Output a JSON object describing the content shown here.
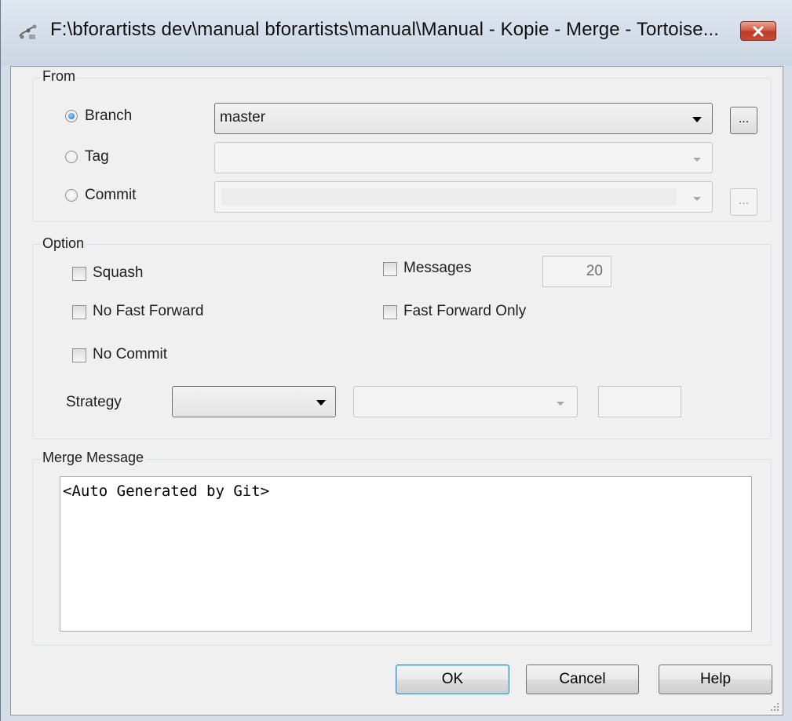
{
  "window": {
    "title": "F:\\bforartists dev\\manual bforartists\\manual\\Manual - Kopie - Merge - Tortoise..."
  },
  "from": {
    "group_label": "From",
    "branch": {
      "label": "Branch",
      "selected": true,
      "value": "master"
    },
    "tag": {
      "label": "Tag",
      "selected": false,
      "value": ""
    },
    "commit": {
      "label": "Commit",
      "selected": false,
      "value": ""
    },
    "browse_label": "..."
  },
  "option": {
    "group_label": "Option",
    "squash": {
      "label": "Squash",
      "checked": false
    },
    "messages": {
      "label": "Messages",
      "checked": false,
      "value": "20"
    },
    "no_fast_forward": {
      "label": "No Fast Forward",
      "checked": false
    },
    "fast_forward_only": {
      "label": "Fast Forward Only",
      "checked": false
    },
    "no_commit": {
      "label": "No Commit",
      "checked": false
    },
    "strategy": {
      "label": "Strategy",
      "value": "",
      "option_value": "",
      "extra": ""
    }
  },
  "merge_message": {
    "group_label": "Merge Message",
    "text": "<Auto Generated by Git>"
  },
  "buttons": {
    "ok": "OK",
    "cancel": "Cancel",
    "help": "Help"
  },
  "colors": {
    "close_button": "#c9503a",
    "default_button_border": "#3c7fb1",
    "radio_dot": "#1c6fc4"
  },
  "icons": [
    "tortoisegit-merge-icon",
    "close-icon",
    "dropdown-arrow-icon",
    "resize-grip-icon"
  ]
}
